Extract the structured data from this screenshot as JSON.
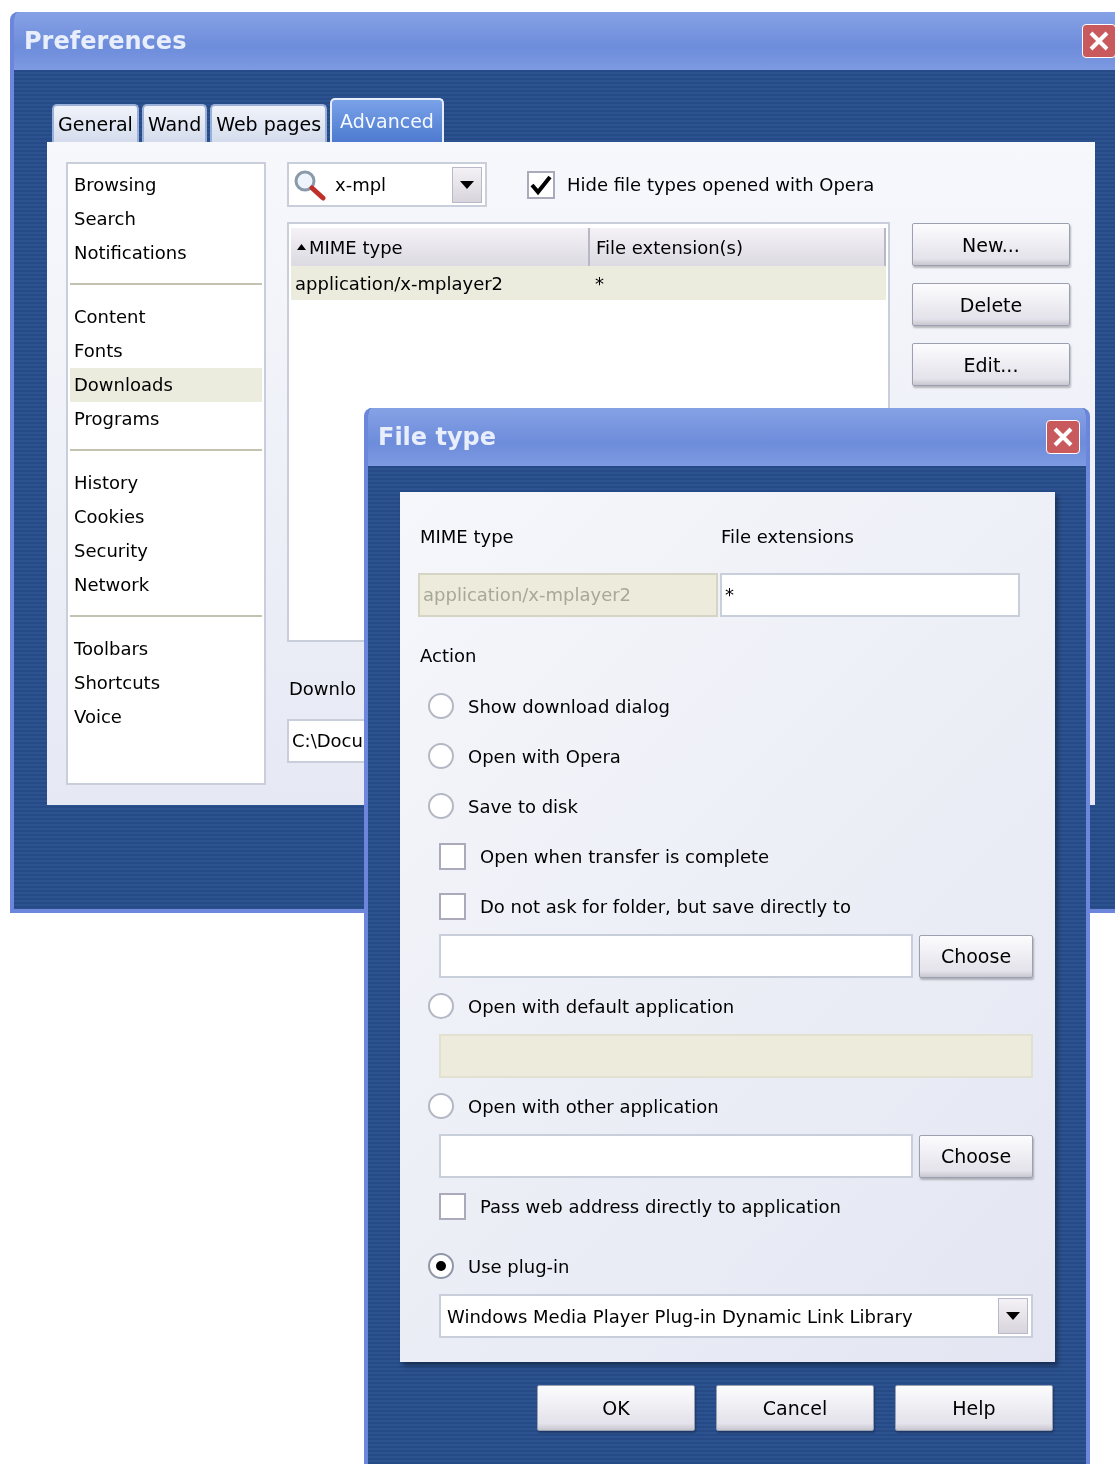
{
  "preferences": {
    "title": "Preferences",
    "tabs": [
      {
        "label": "General",
        "selected": false
      },
      {
        "label": "Wand",
        "selected": false
      },
      {
        "label": "Web pages",
        "selected": false
      },
      {
        "label": "Advanced",
        "selected": true
      }
    ],
    "sidebar": {
      "groups": [
        {
          "items": [
            {
              "label": "Browsing",
              "selected": false
            },
            {
              "label": "Search",
              "selected": false
            },
            {
              "label": "Notifications",
              "selected": false
            }
          ]
        },
        {
          "items": [
            {
              "label": "Content",
              "selected": false
            },
            {
              "label": "Fonts",
              "selected": false
            },
            {
              "label": "Downloads",
              "selected": true
            },
            {
              "label": "Programs",
              "selected": false
            }
          ]
        },
        {
          "items": [
            {
              "label": "History",
              "selected": false
            },
            {
              "label": "Cookies",
              "selected": false
            },
            {
              "label": "Security",
              "selected": false
            },
            {
              "label": "Network",
              "selected": false
            }
          ]
        },
        {
          "items": [
            {
              "label": "Toolbars",
              "selected": false
            },
            {
              "label": "Shortcuts",
              "selected": false
            },
            {
              "label": "Voice",
              "selected": false
            }
          ]
        }
      ]
    },
    "filter": {
      "value": "x-mpl"
    },
    "hide_option": {
      "label": "Hide file types opened with Opera",
      "checked": true
    },
    "table": {
      "columns": [
        {
          "label": "MIME type",
          "sorted": true
        },
        {
          "label": "File extension(s)",
          "sorted": false
        }
      ],
      "rows": [
        {
          "cells": [
            "application/x-mplayer2",
            "*"
          ],
          "selected": true
        }
      ]
    },
    "buttons": [
      "New...",
      "Delete",
      "Edit..."
    ],
    "download_label": "Downlo",
    "download_path": "C:\\Docu"
  },
  "file_type": {
    "title": "File type",
    "mime_label": "MIME type",
    "extensions_label": "File extensions",
    "mime_value": "application/x-mplayer2",
    "extensions_value": "*",
    "action_label": "Action",
    "options": [
      {
        "kind": "radio",
        "label": "Show download dialog",
        "selected": false
      },
      {
        "kind": "radio",
        "label": "Open with Opera",
        "selected": false
      },
      {
        "kind": "radio",
        "label": "Save to disk",
        "selected": false
      },
      {
        "kind": "checkbox",
        "label": "Open when transfer is complete",
        "checked": false
      },
      {
        "kind": "checkbox",
        "label": "Do not ask for folder, but save directly to",
        "checked": false
      },
      {
        "kind": "field",
        "button": "Choose"
      },
      {
        "kind": "radio",
        "label": "Open with default application",
        "selected": false
      },
      {
        "kind": "disabled_field"
      },
      {
        "kind": "radio",
        "label": "Open with other application",
        "selected": false
      },
      {
        "kind": "field",
        "button": "Choose"
      },
      {
        "kind": "checkbox",
        "label": "Pass web address directly to application",
        "checked": false
      },
      {
        "kind": "radio",
        "label": "Use plug-in",
        "selected": true
      },
      {
        "kind": "select",
        "value": "Windows Media Player Plug-in Dynamic Link Library"
      }
    ],
    "buttons": [
      "OK",
      "Cancel",
      "Help"
    ]
  }
}
